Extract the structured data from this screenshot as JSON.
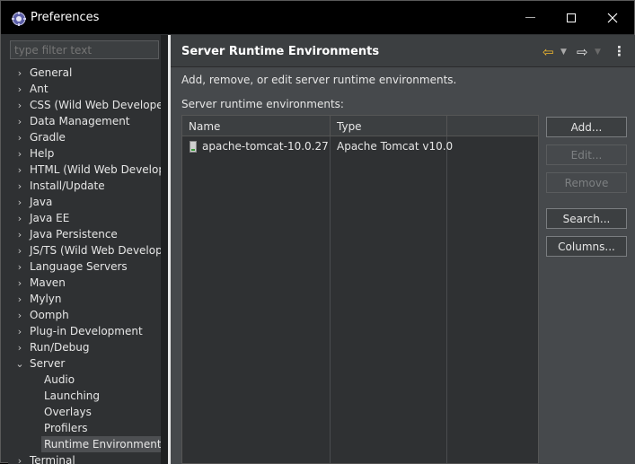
{
  "window": {
    "title": "Preferences",
    "controls": [
      "minimize",
      "maximize",
      "close"
    ]
  },
  "filter": {
    "placeholder": "type filter text"
  },
  "tree": {
    "items": [
      {
        "label": "General",
        "expanded": false
      },
      {
        "label": "Ant",
        "expanded": false
      },
      {
        "label": "CSS (Wild Web Developer)",
        "expanded": false
      },
      {
        "label": "Data Management",
        "expanded": false
      },
      {
        "label": "Gradle",
        "expanded": false
      },
      {
        "label": "Help",
        "expanded": false
      },
      {
        "label": "HTML (Wild Web Developer)",
        "expanded": false
      },
      {
        "label": "Install/Update",
        "expanded": false
      },
      {
        "label": "Java",
        "expanded": false
      },
      {
        "label": "Java EE",
        "expanded": false
      },
      {
        "label": "Java Persistence",
        "expanded": false
      },
      {
        "label": "JS/TS (Wild Web Developer)",
        "expanded": false
      },
      {
        "label": "Language Servers",
        "expanded": false
      },
      {
        "label": "Maven",
        "expanded": false
      },
      {
        "label": "Mylyn",
        "expanded": false
      },
      {
        "label": "Oomph",
        "expanded": false
      },
      {
        "label": "Plug-in Development",
        "expanded": false
      },
      {
        "label": "Run/Debug",
        "expanded": false
      },
      {
        "label": "Server",
        "expanded": true
      },
      {
        "label": "Terminal",
        "expanded": false
      }
    ],
    "server_children": [
      {
        "label": "Audio"
      },
      {
        "label": "Launching"
      },
      {
        "label": "Overlays"
      },
      {
        "label": "Profilers"
      },
      {
        "label": "Runtime Environments",
        "selected": true
      }
    ]
  },
  "page": {
    "title": "Server Runtime Environments",
    "description": "Add, remove, or edit server runtime environments.",
    "table_label": "Server runtime environments:",
    "columns": [
      "Name",
      "Type"
    ],
    "rows": [
      {
        "name": "apache-tomcat-10.0.27",
        "type": "Apache Tomcat v10.0"
      }
    ]
  },
  "buttons": {
    "add": "Add...",
    "edit": "Edit...",
    "remove": "Remove",
    "search": "Search...",
    "columns": "Columns..."
  },
  "colors": {
    "back_arrow": "#f2b92f",
    "titlebar": "#000000",
    "pane_bg": "#46494c"
  }
}
